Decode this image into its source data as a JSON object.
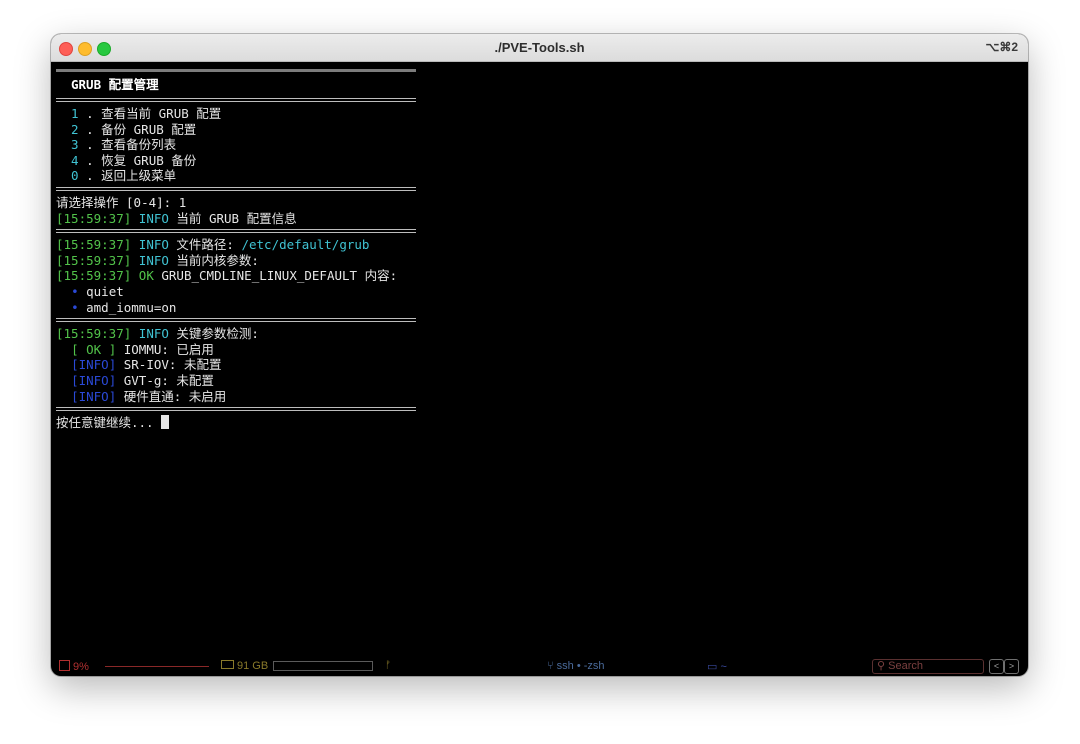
{
  "window": {
    "title": "./PVE-Tools.sh",
    "shortcut": "⌥⌘2"
  },
  "header": {
    "title": "GRUB 配置管理"
  },
  "menu": [
    {
      "num": "1",
      "label": ". 查看当前 GRUB 配置"
    },
    {
      "num": "2",
      "label": ". 备份 GRUB 配置"
    },
    {
      "num": "3",
      "label": ". 查看备份列表"
    },
    {
      "num": "4",
      "label": ". 恢复 GRUB 备份"
    },
    {
      "num": "0",
      "label": ". 返回上级菜单"
    }
  ],
  "prompt": {
    "text": "请选择操作 [0-4]: 1"
  },
  "log1": {
    "time": "[15:59:37]",
    "level": "INFO",
    "msg": " 当前 GRUB 配置信息"
  },
  "log2": {
    "time": "[15:59:37]",
    "level": "INFO",
    "msg": " 文件路径: ",
    "path": "/etc/default/grub"
  },
  "log3": {
    "time": "[15:59:37]",
    "level": "INFO",
    "msg": " 当前内核参数:"
  },
  "log4": {
    "time": "[15:59:37]",
    "level": "OK",
    "msg": " GRUB_CMDLINE_LINUX_DEFAULT 内容:"
  },
  "params": [
    {
      "bullet": "•",
      "value": "quiet"
    },
    {
      "bullet": "•",
      "value": "amd_iommu=on"
    }
  ],
  "log5": {
    "time": "[15:59:37]",
    "level": "INFO",
    "msg": " 关键参数检测:"
  },
  "checks": [
    {
      "tag": "[ OK ]",
      "text": " IOMMU: 已启用"
    },
    {
      "tag": "[INFO]",
      "text": " SR-IOV: 未配置"
    },
    {
      "tag": "[INFO]",
      "text": " GVT-g: 未配置"
    },
    {
      "tag": "[INFO]",
      "text": " 硬件直通: 未启用"
    }
  ],
  "continue_prompt": {
    "text": "按任意键继续... "
  },
  "status": {
    "cpu": "9%",
    "ram": "91 GB",
    "session": "ssh • -zsh",
    "dir": "~",
    "search_placeholder": "Search"
  },
  "colors": {
    "cyan": "#40c3d3",
    "green": "#52c34a",
    "blue": "#2a49d6",
    "cpu_red": "#b03030"
  }
}
